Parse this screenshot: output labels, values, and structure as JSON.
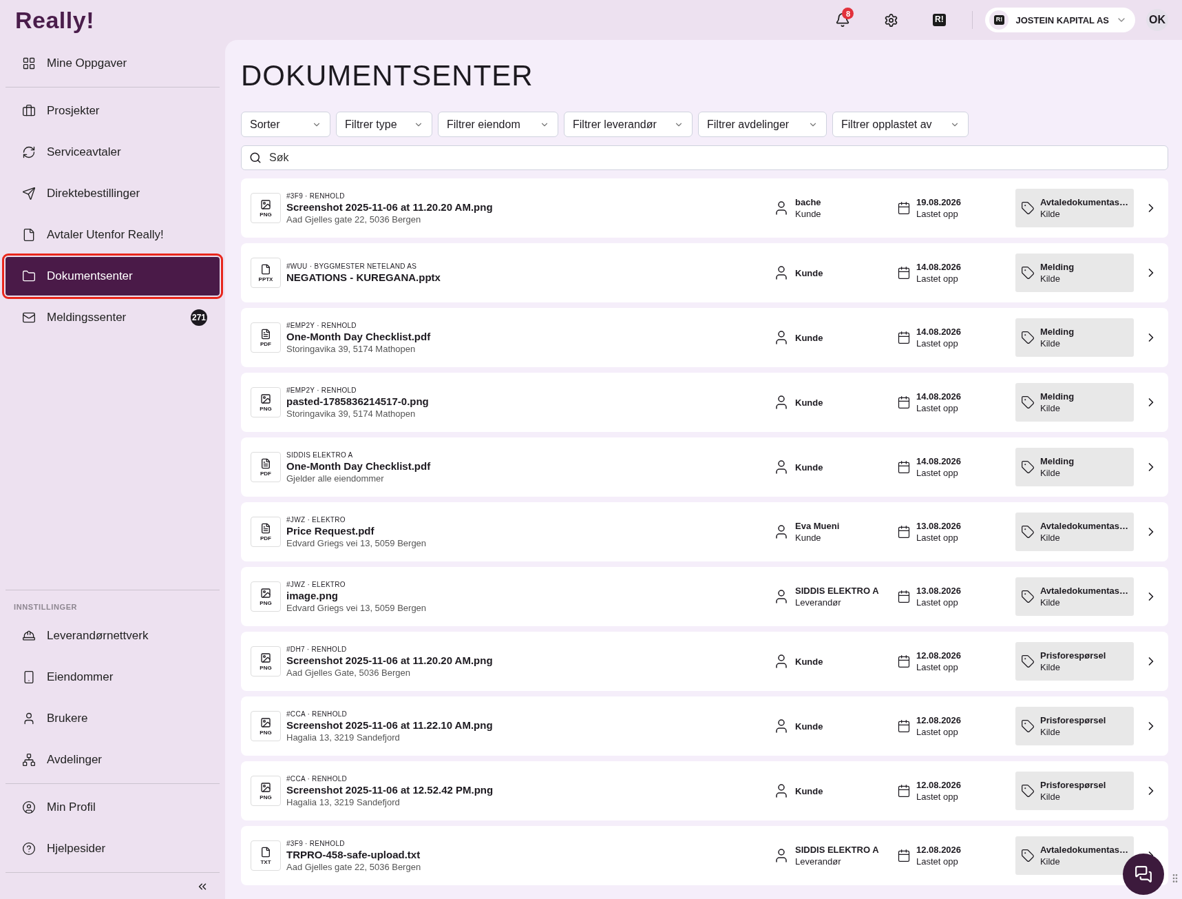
{
  "logo": "Really!",
  "header": {
    "notifications": "8",
    "org_logo": "R!",
    "account": {
      "logo": "R!",
      "name": "JOSTEIN KAPITAL AS"
    },
    "user_initials": "OK"
  },
  "sidebar": {
    "groups": [
      {
        "items": [
          {
            "label": "Mine Oppgaver",
            "selected": false,
            "highlighted": false
          }
        ]
      },
      {
        "items": [
          {
            "label": "Prosjekter",
            "selected": false,
            "highlighted": false
          },
          {
            "label": "Serviceavtaler",
            "selected": false,
            "highlighted": false
          },
          {
            "label": "Direktebestillinger",
            "selected": false,
            "highlighted": false
          },
          {
            "label": "Avtaler Utenfor Really!",
            "selected": false,
            "highlighted": false
          },
          {
            "label": "Dokumentsenter",
            "selected": true,
            "highlighted": true
          },
          {
            "label": "Meldingssenter",
            "selected": false,
            "highlighted": false,
            "badge": "271"
          }
        ]
      },
      {
        "heading": "INNSTILLINGER",
        "items": [
          {
            "label": "Leverandørnettverk",
            "selected": false,
            "highlighted": false
          },
          {
            "label": "Eiendommer",
            "selected": false,
            "highlighted": false
          },
          {
            "label": "Brukere",
            "selected": false,
            "highlighted": false
          },
          {
            "label": "Avdelinger",
            "selected": false,
            "highlighted": false
          }
        ]
      },
      {
        "items": [
          {
            "label": "Min Profil",
            "selected": false,
            "highlighted": false
          },
          {
            "label": "Hjelpesider",
            "selected": false,
            "highlighted": false
          }
        ]
      }
    ]
  },
  "page": {
    "title": "DOKUMENTSENTER",
    "filters": [
      "Sorter",
      "Filtrer type",
      "Filtrer eiendom",
      "Filtrer leverandør",
      "Filtrer avdelinger",
      "Filtrer opplastet av"
    ],
    "search": {
      "placeholder": "Søk"
    },
    "documents": [
      {
        "kind": "image",
        "filetype": "PNG",
        "meta": "#3F9 · RENHOLD",
        "name": "Screenshot 2025-11-06 at 11.20.20 AM.png",
        "address": "Aad Gjelles gate 22, 5036 Bergen",
        "person": {
          "name": "bache",
          "role": "Kunde"
        },
        "date": "19.08.2026",
        "date_label": "Lastet opp",
        "source": "Avtaledokumentas…",
        "source_label": "Kilde"
      },
      {
        "kind": "file",
        "filetype": "PPTX",
        "meta": "#WUU · BYGGMESTER NETELAND AS",
        "name": "NEGATIONS - KUREGANA.pptx",
        "person": {
          "role": "Kunde"
        },
        "date": "14.08.2026",
        "date_label": "Lastet opp",
        "source": "Melding",
        "source_label": "Kilde"
      },
      {
        "kind": "pdf",
        "filetype": "PDF",
        "meta": "#EMP2Y · RENHOLD",
        "name": "One-Month Day Checklist.pdf",
        "address": "Storingavika 39, 5174 Mathopen",
        "person": {
          "role": "Kunde"
        },
        "date": "14.08.2026",
        "date_label": "Lastet opp",
        "source": "Melding",
        "source_label": "Kilde"
      },
      {
        "kind": "image",
        "filetype": "PNG",
        "meta": "#EMP2Y · RENHOLD",
        "name": "pasted-1785836214517-0.png",
        "address": "Storingavika 39, 5174 Mathopen",
        "person": {
          "role": "Kunde"
        },
        "date": "14.08.2026",
        "date_label": "Lastet opp",
        "source": "Melding",
        "source_label": "Kilde"
      },
      {
        "kind": "pdf",
        "filetype": "PDF",
        "meta": "SIDDIS ELEKTRO A",
        "name": "One-Month Day Checklist.pdf",
        "address": "Gjelder alle eiendommer",
        "person": {
          "role": "Kunde"
        },
        "date": "14.08.2026",
        "date_label": "Lastet opp",
        "source": "Melding",
        "source_label": "Kilde"
      },
      {
        "kind": "pdf",
        "filetype": "PDF",
        "meta": "#JWZ · ELEKTRO",
        "name": "Price Request.pdf",
        "address": "Edvard Griegs vei 13, 5059 Bergen",
        "person": {
          "name": "Eva Mueni",
          "role": "Kunde"
        },
        "date": "13.08.2026",
        "date_label": "Lastet opp",
        "source": "Avtaledokumentas…",
        "source_label": "Kilde"
      },
      {
        "kind": "image",
        "filetype": "PNG",
        "meta": "#JWZ · ELEKTRO",
        "name": "image.png",
        "address": "Edvard Griegs vei 13, 5059 Bergen",
        "person": {
          "name": "SIDDIS ELEKTRO A",
          "role": "Leverandør"
        },
        "date": "13.08.2026",
        "date_label": "Lastet opp",
        "source": "Avtaledokumentas…",
        "source_label": "Kilde"
      },
      {
        "kind": "image",
        "filetype": "PNG",
        "meta": "#DH7 · RENHOLD",
        "name": "Screenshot 2025-11-06 at 11.20.20 AM.png",
        "address": "Aad Gjelles Gate, 5036 Bergen",
        "person": {
          "role": "Kunde"
        },
        "date": "12.08.2026",
        "date_label": "Lastet opp",
        "source": "Prisforespørsel",
        "source_label": "Kilde"
      },
      {
        "kind": "image",
        "filetype": "PNG",
        "meta": "#CCA · RENHOLD",
        "name": "Screenshot 2025-11-06 at 11.22.10 AM.png",
        "address": "Hagalia 13, 3219 Sandefjord",
        "person": {
          "role": "Kunde"
        },
        "date": "12.08.2026",
        "date_label": "Lastet opp",
        "source": "Prisforespørsel",
        "source_label": "Kilde"
      },
      {
        "kind": "image",
        "filetype": "PNG",
        "meta": "#CCA · RENHOLD",
        "name": "Screenshot 2025-11-06 at 12.52.42 PM.png",
        "address": "Hagalia 13, 3219 Sandefjord",
        "person": {
          "role": "Kunde"
        },
        "date": "12.08.2026",
        "date_label": "Lastet opp",
        "source": "Prisforespørsel",
        "source_label": "Kilde"
      },
      {
        "kind": "file",
        "filetype": "TXT",
        "meta": "#3F9 · RENHOLD",
        "name": "TRPRO-458-safe-upload.txt",
        "address": "Aad Gjelles gate 22, 5036 Bergen",
        "person": {
          "name": "SIDDIS ELEKTRO A",
          "role": "Leverandør"
        },
        "date": "12.08.2026",
        "date_label": "Lastet opp",
        "source": "Avtaledokumentas…",
        "source_label": "Kilde"
      }
    ]
  }
}
